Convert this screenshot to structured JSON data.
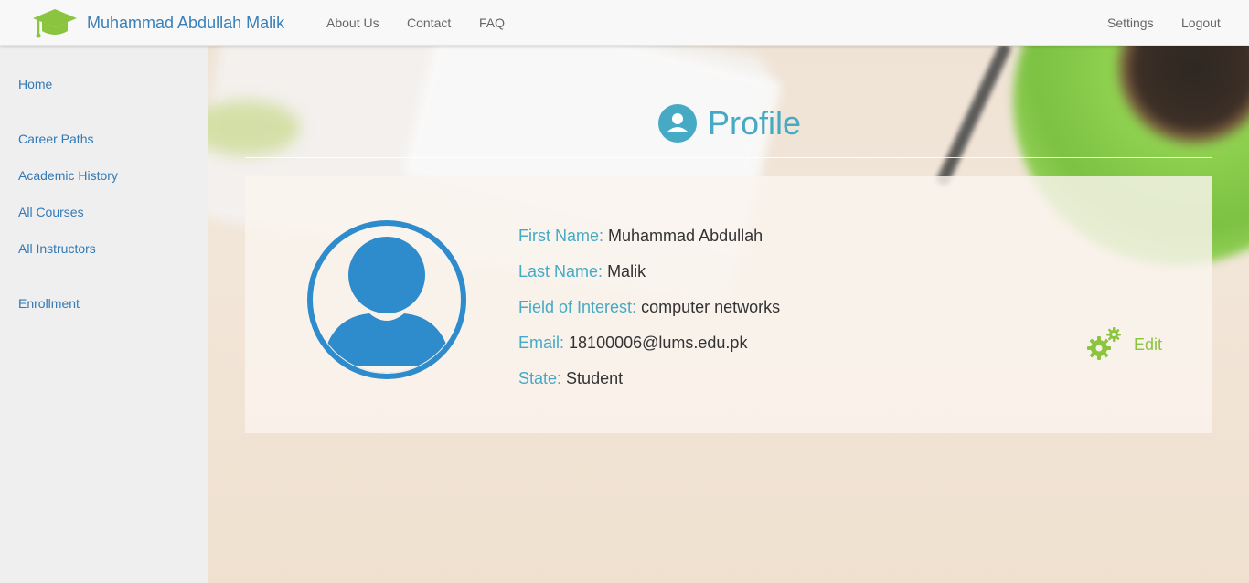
{
  "navbar": {
    "brand": "Muhammad Abdullah Malik",
    "brand_icon": "graduation-cap-icon",
    "links": {
      "about": "About Us",
      "contact": "Contact",
      "faq": "FAQ"
    },
    "right": {
      "settings": "Settings",
      "logout": "Logout"
    }
  },
  "sidebar": {
    "home": "Home",
    "career_paths": "Career Paths",
    "academic_history": "Academic History",
    "all_courses": "All Courses",
    "all_instructors": "All Instructors",
    "enrollment": "Enrollment"
  },
  "profile": {
    "title": "Profile",
    "title_icon": "user-circle-icon",
    "avatar_icon": "user-avatar-icon",
    "fields": {
      "first_name": {
        "label": "First Name:",
        "value": "Muhammad Abdullah"
      },
      "last_name": {
        "label": "Last Name:",
        "value": "Malik"
      },
      "field_of_interest": {
        "label": "Field of Interest:",
        "value": "computer networks"
      },
      "email": {
        "label": "Email:",
        "value": "18100006@lums.edu.pk"
      },
      "state": {
        "label": "State:",
        "value": "Student"
      }
    },
    "edit": {
      "label": "Edit",
      "icon": "gears-icon"
    }
  },
  "colors": {
    "brand_text": "#3a7fb8",
    "link": "#337ab7",
    "accent_teal": "#46aac4",
    "avatar_blue": "#2e8bcc",
    "edit_green": "#8bc53f"
  }
}
